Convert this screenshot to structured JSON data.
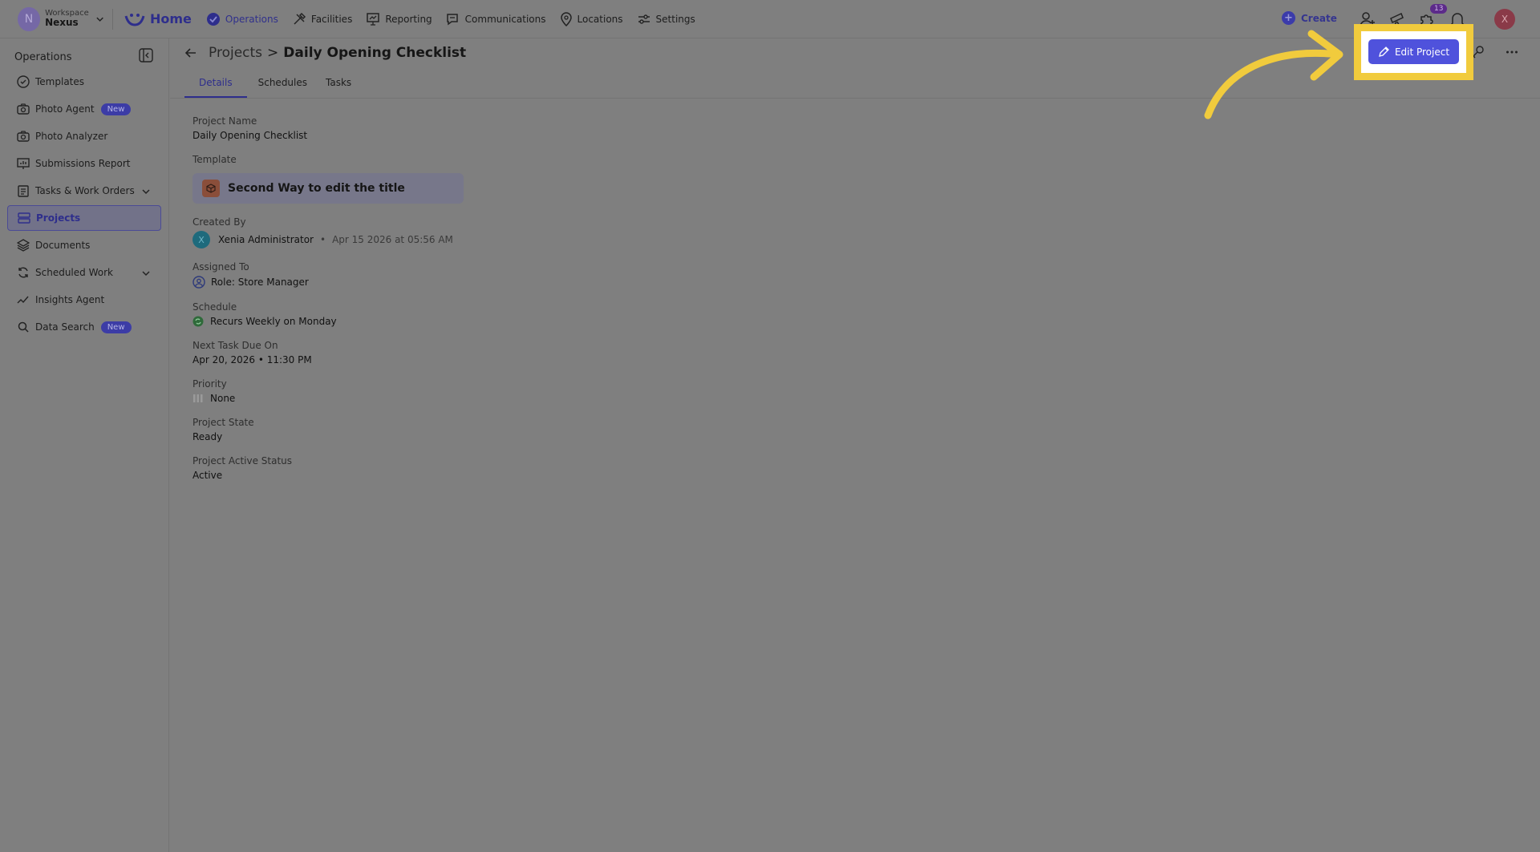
{
  "workspace": {
    "label": "Workspace",
    "name": "Nexus",
    "initial": "N"
  },
  "nav": {
    "home": "Home",
    "items": [
      {
        "label": "Operations",
        "icon": "check-circle-icon",
        "active": true
      },
      {
        "label": "Facilities",
        "icon": "tools-icon"
      },
      {
        "label": "Reporting",
        "icon": "presentation-icon"
      },
      {
        "label": "Communications",
        "icon": "chat-icon"
      },
      {
        "label": "Locations",
        "icon": "pin-icon"
      },
      {
        "label": "Settings",
        "icon": "sliders-icon"
      }
    ]
  },
  "topbar": {
    "create_label": "Create",
    "notification_count": "13",
    "user_initial": "X"
  },
  "sidebar": {
    "title": "Operations",
    "items": [
      {
        "label": "Templates",
        "icon": "check-circle-icon"
      },
      {
        "label": "Photo Agent",
        "icon": "camera-icon",
        "badge": "New"
      },
      {
        "label": "Photo Analyzer",
        "icon": "camera-icon"
      },
      {
        "label": "Submissions Report",
        "icon": "chart-icon"
      },
      {
        "label": "Tasks & Work Orders",
        "icon": "clipboard-icon",
        "expandable": true
      },
      {
        "label": "Projects",
        "icon": "server-icon",
        "active": true
      },
      {
        "label": "Documents",
        "icon": "layers-icon"
      },
      {
        "label": "Scheduled Work",
        "icon": "refresh-icon",
        "expandable": true
      },
      {
        "label": "Insights Agent",
        "icon": "trend-icon"
      },
      {
        "label": "Data Search",
        "icon": "search-icon",
        "badge": "New"
      }
    ]
  },
  "breadcrumb": {
    "parent": "Projects",
    "separator": ">",
    "current": "Daily Opening Checklist"
  },
  "tabs": [
    "Details",
    "Schedules",
    "Tasks"
  ],
  "details": {
    "project_name_label": "Project Name",
    "project_name": "Daily Opening Checklist",
    "template_label": "Template",
    "template_name": "Second Way to edit the title",
    "created_by_label": "Created By",
    "created_by_initial": "X",
    "created_by": "Xenia Administrator",
    "created_at": "Apr 15 2026 at 05:56 AM",
    "assigned_to_label": "Assigned To",
    "assigned_to": "Role: Store Manager",
    "schedule_label": "Schedule",
    "schedule": "Recurs Weekly on Monday",
    "next_due_label": "Next Task Due On",
    "next_due": "Apr 20, 2026 • 11:30 PM",
    "priority_label": "Priority",
    "priority": "None",
    "state_label": "Project State",
    "state": "Ready",
    "active_status_label": "Project Active Status",
    "active_status": "Active"
  },
  "actions": {
    "edit_project": "Edit Project"
  },
  "colors": {
    "accent": "#4f52dc",
    "highlight": "#f1cb3d",
    "overlay": "#7f7f7f"
  }
}
